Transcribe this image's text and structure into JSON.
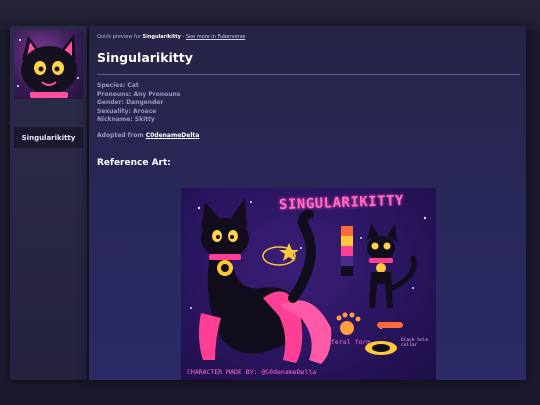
{
  "sidebar": {
    "name": "Singularikitty",
    "avatar_icon": "cat-avatar-icon"
  },
  "preview": {
    "prefix": "Quick preview for ",
    "character": "Singularikitty",
    "separator": " - ",
    "link": "See more in Fuberverse"
  },
  "title": "Singularikitty",
  "info": [
    "Species: Cat",
    "Pronouns: Any Pronouns",
    "Gender: Dangender",
    "Sexuality: Aroace",
    "Nickname: Skitty"
  ],
  "adopted": {
    "label": "Adopted from ",
    "user": "C0denameDelta"
  },
  "reference_heading": "Reference Art:",
  "reference_art": {
    "title": "SINGULARIKITTY",
    "credit": "CHARACTER MADE BY: @C0denameDelta",
    "feral_label": "feral form",
    "collar_label": "black hole collar"
  },
  "colors": {
    "accent_pink": "#ff6ec7",
    "gold": "#ffc83a",
    "background": "#1b1a2c",
    "card": "#2b2a66"
  }
}
